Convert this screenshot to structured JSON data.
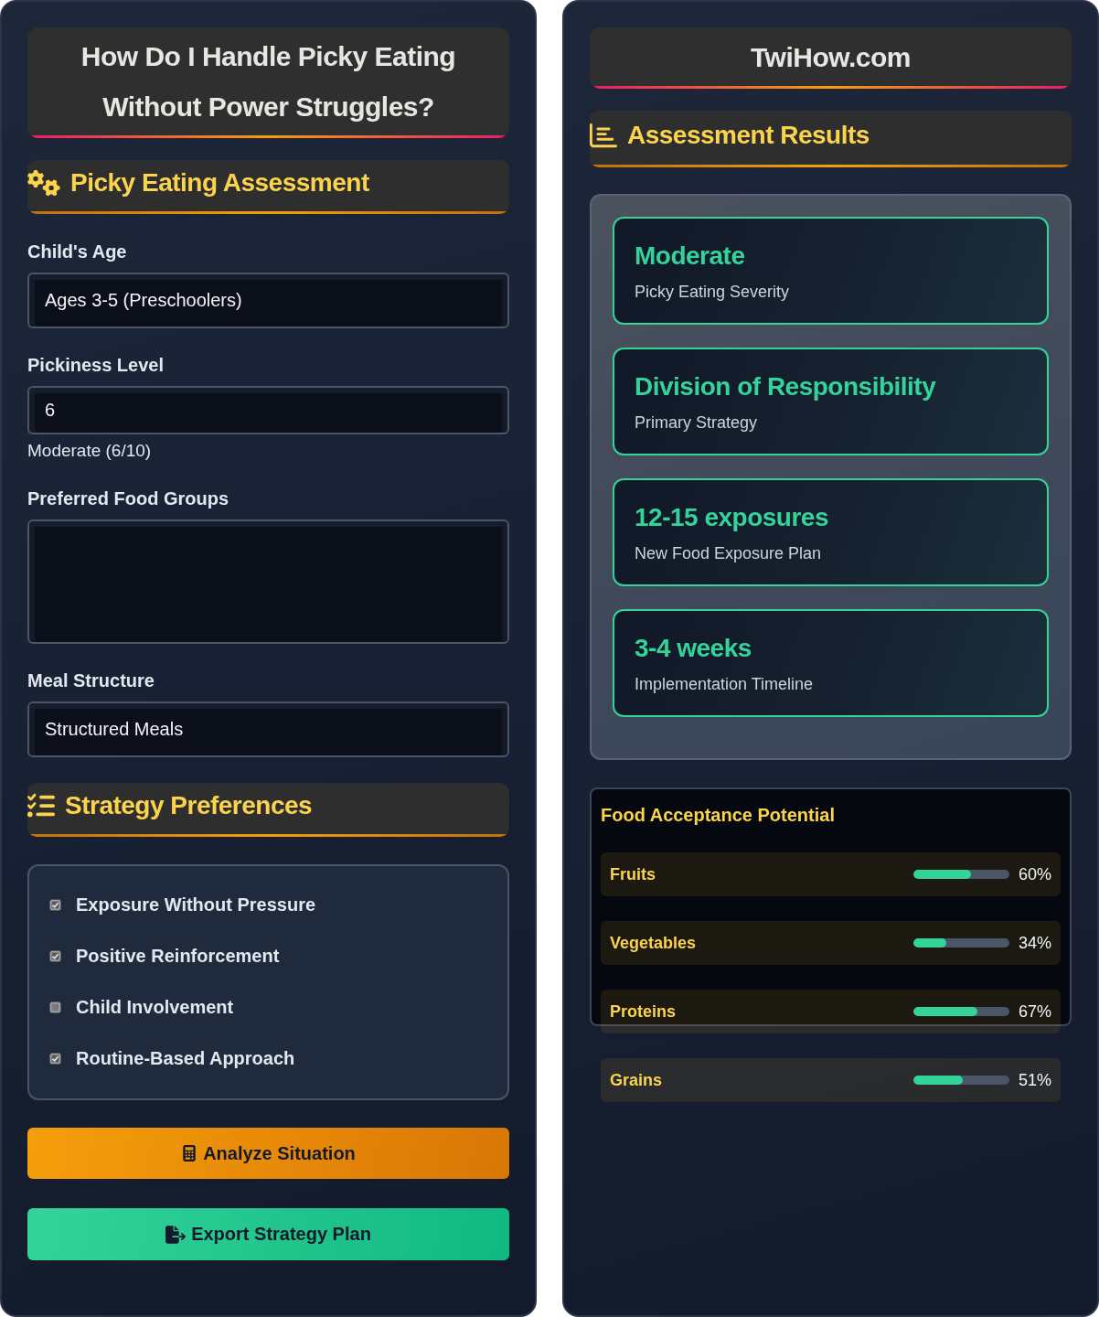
{
  "form_panel": {
    "title": "How Do I Handle Picky Eating Without Power Struggles?",
    "assessment_heading": "Picky Eating Assessment",
    "fields": [
      {
        "kind": "select",
        "label": "Child's Age",
        "value": "Ages 3-5 (Preschoolers)"
      },
      {
        "kind": "number",
        "label": "Pickiness Level",
        "value": "6",
        "note": "Moderate (6/10)"
      },
      {
        "kind": "multiselect",
        "label": "Preferred Food Groups"
      },
      {
        "kind": "select",
        "label": "Meal Structure",
        "value": "Structured Meals"
      }
    ],
    "strategy_heading": "Strategy Preferences",
    "strategies": [
      {
        "label": "Exposure Without Pressure",
        "checked": true
      },
      {
        "label": "Positive Reinforcement",
        "checked": true
      },
      {
        "label": "Child Involvement",
        "checked": false
      },
      {
        "label": "Routine-Based Approach",
        "checked": true
      }
    ],
    "buttons": [
      {
        "kind": "analyze",
        "label": "Analyze Situation"
      },
      {
        "kind": "export",
        "label": "Export Strategy Plan"
      }
    ]
  },
  "results_panel": {
    "site_title": "TwiHow.com",
    "results_heading": "Assessment Results",
    "results": [
      {
        "value": "Moderate",
        "label": "Picky Eating Severity"
      },
      {
        "value": "Division of Responsibility",
        "label": "Primary Strategy"
      },
      {
        "value": "12-15 exposures",
        "label": "New Food Exposure Plan"
      },
      {
        "value": "3-4 weeks",
        "label": "Implementation Timeline"
      }
    ],
    "acceptance": {
      "title": "Food Acceptance Potential",
      "foods": [
        {
          "name": "Fruits",
          "level": 0.6,
          "reading": "60%"
        },
        {
          "name": "Vegetables",
          "level": 0.34,
          "reading": "34%"
        },
        {
          "name": "Proteins",
          "level": 0.67,
          "reading": "67%"
        },
        {
          "name": "Grains",
          "level": 0.51,
          "reading": "51%"
        }
      ]
    }
  }
}
